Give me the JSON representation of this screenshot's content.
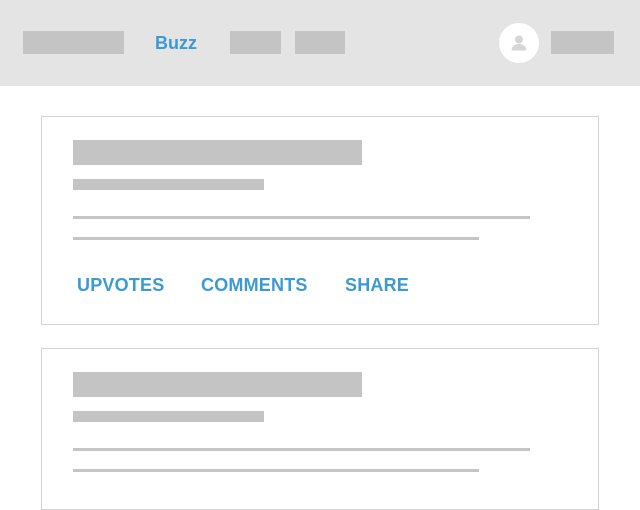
{
  "header": {
    "active_nav_label": "Buzz"
  },
  "post_actions": {
    "upvotes_label": "UPVOTES",
    "comments_label": "COMMENTS",
    "share_label": "SHARE"
  },
  "colors": {
    "accent": "#3c9ad3",
    "header_bg": "#e4e4e4",
    "placeholder": "#c4c4c4"
  },
  "icons": {
    "avatar": "user-icon"
  }
}
